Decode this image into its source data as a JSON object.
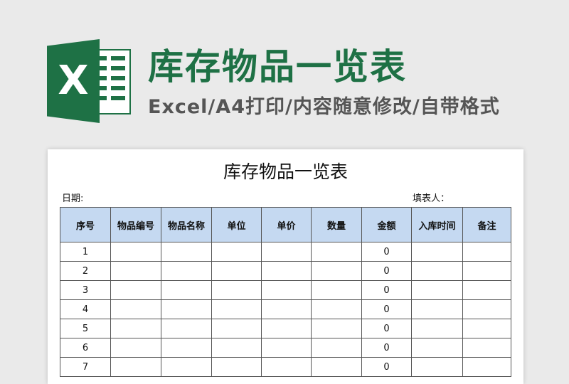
{
  "banner": {
    "logo_letter": "X",
    "title": "库存物品一览表",
    "subtitle": "Excel/A4打印/内容随意修改/自带格式",
    "accent_color": "#1e7145"
  },
  "sheet": {
    "title": "库存物品一览表",
    "date_label": "日期:",
    "filler_label": "填表人：",
    "header_color": "#c5d9f1",
    "columns": [
      "序号",
      "物品编号",
      "物品名称",
      "单位",
      "单价",
      "数量",
      "金额",
      "入库时间",
      "备注"
    ],
    "rows": [
      [
        "1",
        "",
        "",
        "",
        "",
        "",
        "0",
        "",
        ""
      ],
      [
        "2",
        "",
        "",
        "",
        "",
        "",
        "0",
        "",
        ""
      ],
      [
        "3",
        "",
        "",
        "",
        "",
        "",
        "0",
        "",
        ""
      ],
      [
        "4",
        "",
        "",
        "",
        "",
        "",
        "0",
        "",
        ""
      ],
      [
        "5",
        "",
        "",
        "",
        "",
        "",
        "0",
        "",
        ""
      ],
      [
        "6",
        "",
        "",
        "",
        "",
        "",
        "0",
        "",
        ""
      ],
      [
        "7",
        "",
        "",
        "",
        "",
        "",
        "0",
        "",
        ""
      ]
    ]
  }
}
